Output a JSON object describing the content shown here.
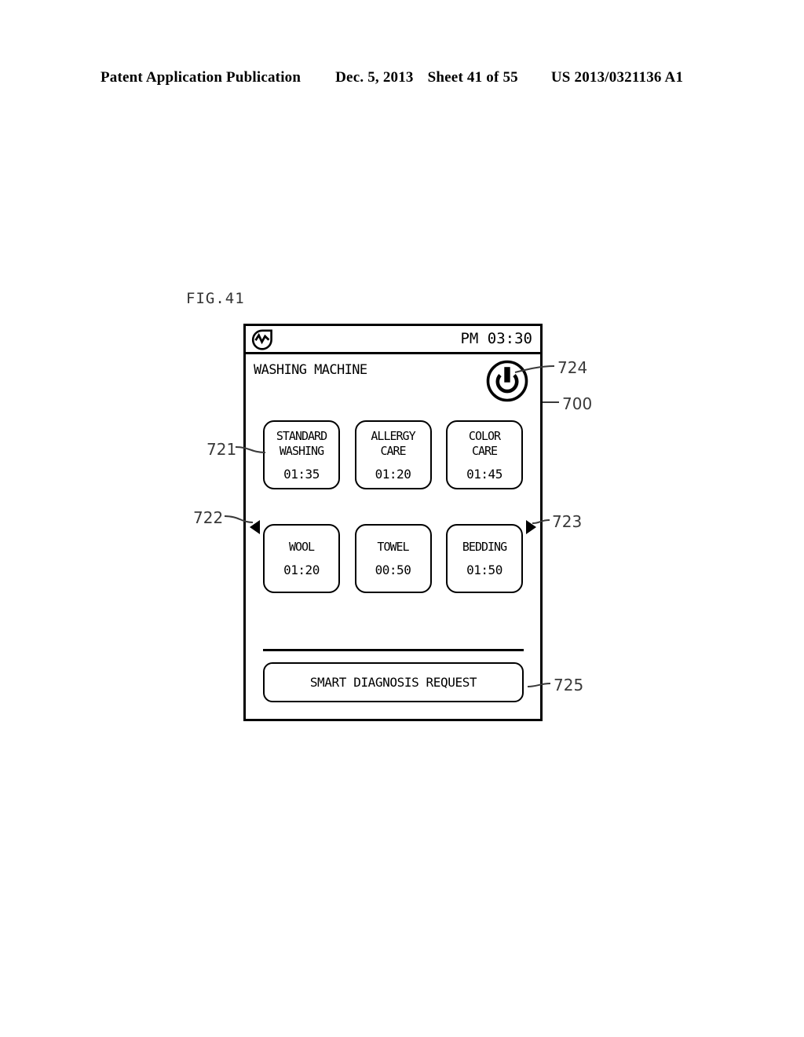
{
  "page_header": {
    "publication": "Patent Application Publication",
    "date": "Dec. 5, 2013",
    "sheet": "Sheet 41 of 55",
    "patent_number": "US 2013/0321136 A1"
  },
  "figure": {
    "label": "FIG.41"
  },
  "device": {
    "status_bar": {
      "logo_icon": "brand-wave-shield-icon",
      "time": "PM 03:30"
    },
    "title": "WASHING MACHINE",
    "power_button": {
      "icon": "power-icon"
    },
    "paging": {
      "left_arrow_icon": "triangle-left-icon",
      "right_arrow_icon": "triangle-right-icon"
    },
    "programs_row1": [
      {
        "name": "STANDARD\nWASHING",
        "time": "01:35"
      },
      {
        "name": "ALLERGY\nCARE",
        "time": "01:20"
      },
      {
        "name": "COLOR\nCARE",
        "time": "01:45"
      }
    ],
    "programs_row2": [
      {
        "name": "WOOL",
        "time": "01:20"
      },
      {
        "name": "TOWEL",
        "time": "00:50"
      },
      {
        "name": "BEDDING",
        "time": "01:50"
      }
    ],
    "diagnosis_button": "SMART DIAGNOSIS REQUEST"
  },
  "reference_numerals": {
    "program_button": "721",
    "left_arrow": "722",
    "right_arrow": "723",
    "power_button": "724",
    "device": "700",
    "diagnosis_button": "725"
  },
  "colors": {
    "ink": "#000000",
    "leader": "#3a3a3a",
    "paper": "#ffffff"
  }
}
